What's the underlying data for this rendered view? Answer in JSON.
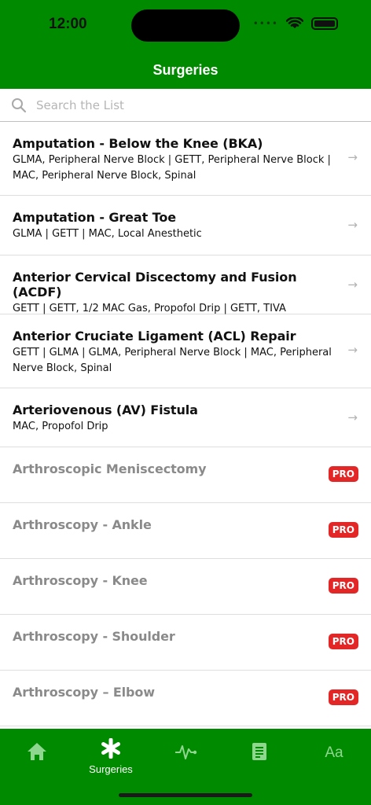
{
  "status": {
    "time": "12:00"
  },
  "header": {
    "title": "Surgeries"
  },
  "search": {
    "placeholder": "Search the List"
  },
  "items": [
    {
      "title": "Amputation - Below the Knee (BKA)",
      "subtitle": "GLMA, Peripheral Nerve Block | GETT, Peripheral Nerve Block | MAC, Peripheral Nerve Block, Spinal",
      "locked": false
    },
    {
      "title": "Amputation - Great Toe",
      "subtitle": "GLMA | GETT | MAC, Local Anesthetic",
      "locked": false
    },
    {
      "title": "Anterior Cervical Discectomy and Fusion (ACDF)",
      "subtitle": "GETT | GETT, 1/2 MAC Gas, Propofol Drip | GETT, TIVA",
      "locked": false
    },
    {
      "title": "Anterior Cruciate Ligament (ACL) Repair",
      "subtitle": "GETT | GLMA | GLMA, Peripheral Nerve Block | MAC, Peripheral Nerve Block, Spinal",
      "locked": false
    },
    {
      "title": "Arteriovenous (AV) Fistula",
      "subtitle": "MAC, Propofol Drip",
      "locked": false
    },
    {
      "title": "Arthroscopic Meniscectomy",
      "badge": "PRO",
      "locked": true
    },
    {
      "title": "Arthroscopy - Ankle",
      "badge": "PRO",
      "locked": true
    },
    {
      "title": "Arthroscopy - Knee",
      "badge": "PRO",
      "locked": true
    },
    {
      "title": "Arthroscopy - Shoulder",
      "badge": "PRO",
      "locked": true
    },
    {
      "title": "Arthroscopy – Elbow",
      "badge": "PRO",
      "locked": true
    }
  ],
  "tabbar": {
    "active_label": "Surgeries",
    "font_tab_label": "Aa",
    "icons": [
      "home-icon",
      "asterisk-icon",
      "pulse-icon",
      "document-icon",
      "text-size-icon"
    ]
  },
  "colors": {
    "brand_green": "#008a00",
    "pro_red": "#e32626",
    "locked_text": "#8a8a8a"
  }
}
